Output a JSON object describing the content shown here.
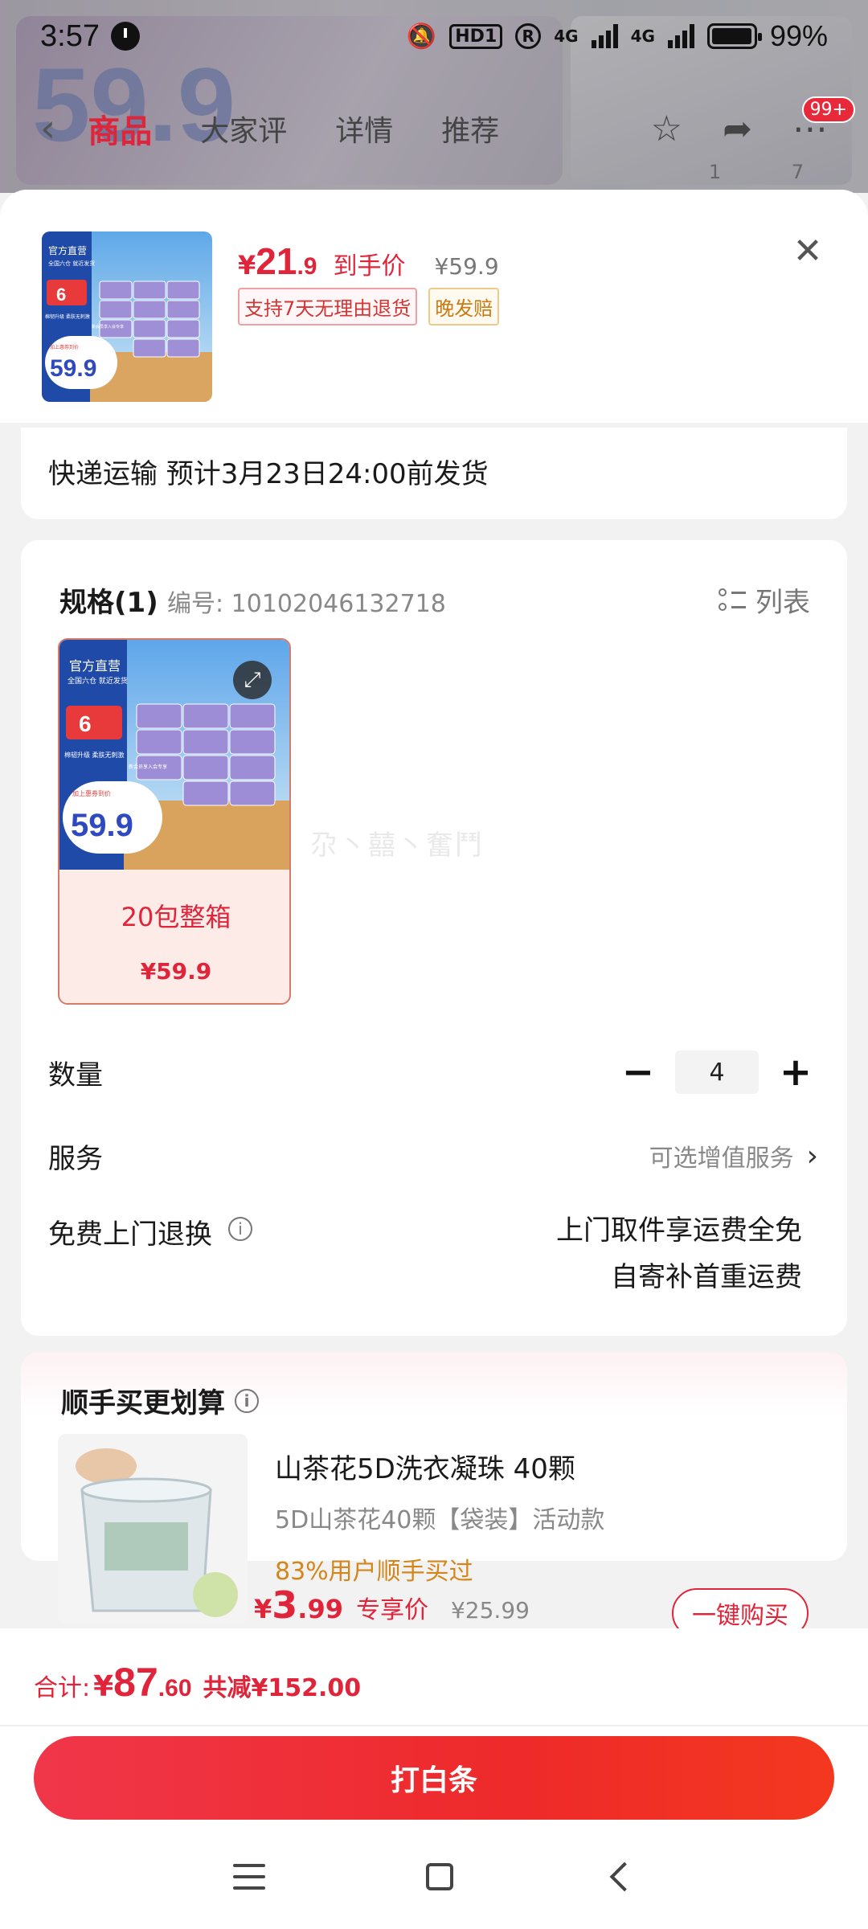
{
  "status_bar": {
    "time": "3:57",
    "hd": "HD1",
    "net1": "4G",
    "net2": "4G",
    "battery_pct": "99%",
    "battery_level": 0.99
  },
  "background_page": {
    "promo_price": "59.9",
    "tabs": [
      {
        "label": "商品",
        "active": true
      },
      {
        "label": "大家评",
        "active": false
      },
      {
        "label": "详情",
        "active": false
      },
      {
        "label": "推荐",
        "active": false
      }
    ],
    "cart_badge": "99+",
    "pager": "1 7"
  },
  "product": {
    "price_symbol": "¥",
    "price_int": "21",
    "price_dec": ".9",
    "price_tag": "到手价",
    "original_price": "¥59.9",
    "badges": [
      "支持7天无理由退货",
      "晚发赔"
    ],
    "thumb_text": {
      "headline": "官方直营",
      "sub": "全国六仓 就近发货",
      "gift": "6",
      "gift_text": "新会员享入会专享",
      "upgrade": "棉韧升级 柔肤无刺激",
      "promo_label": "加上惠券到价",
      "promo_price": "59.9"
    }
  },
  "shipping": {
    "text": "快递运输 预计3月23日24:00前发货"
  },
  "spec": {
    "title": "规格(1)",
    "number": "编号: 10102046132718",
    "list_label": "列表",
    "watermark": "尕丶囍丶奮鬥",
    "sku": {
      "name": "20包整箱",
      "price": "¥59.9"
    }
  },
  "quantity": {
    "label": "数量",
    "minus": "−",
    "plus": "+",
    "value": "4"
  },
  "service": {
    "label": "服务",
    "value": "可选增值服务"
  },
  "free_return": {
    "label": "免费上门退换",
    "line1": "上门取件享运费全免",
    "line2": "自寄补首重运费"
  },
  "bundle": {
    "title": "顺手买更划算",
    "name": "山茶花5D洗衣凝珠 40颗",
    "variant": "5D山茶花40颗【袋装】活动款",
    "social": "83%用户顺手买过",
    "price_symbol": "¥",
    "price_int": "3",
    "price_dec": ".99",
    "price_tag": "专享价",
    "original_price": "¥25.99",
    "buy_label": "一键购买"
  },
  "footer": {
    "total_label": "合计:",
    "total_symbol": "¥",
    "total_int": "87",
    "total_dec": ".60",
    "saved": "共减¥152.00",
    "pay_button": "打白条"
  },
  "colors": {
    "accent": "#e0243a",
    "secondary": "#d4861b"
  }
}
